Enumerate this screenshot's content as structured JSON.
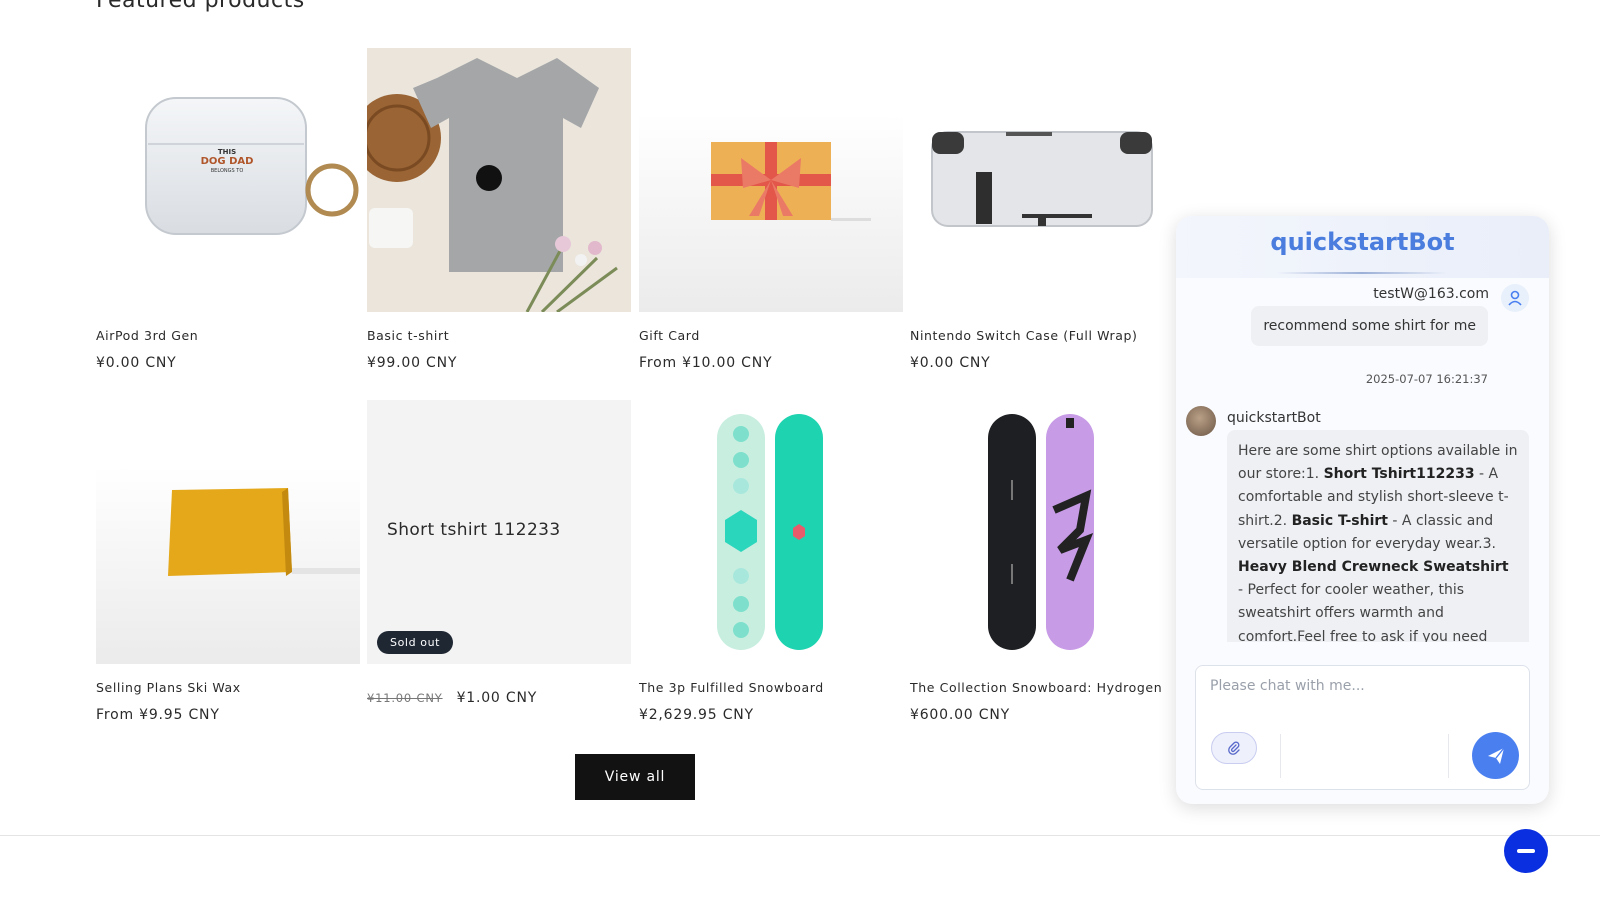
{
  "section": {
    "title": "Featured products"
  },
  "products": [
    {
      "title": "AirPod 3rd Gen",
      "price": "¥0.00 CNY"
    },
    {
      "title": "Basic t-shirt",
      "price": "¥99.00 CNY"
    },
    {
      "title": "Gift Card",
      "price": "From ¥10.00 CNY"
    },
    {
      "title": "Nintendo Switch Case (Full Wrap)",
      "price": "¥0.00 CNY"
    },
    {
      "title": "Selling Plans Ski Wax",
      "price": "From ¥9.95 CNY"
    },
    {
      "title": "",
      "placeholder": "Short tshirt 112233",
      "badge": "Sold out",
      "compare_price": "¥11.00 CNY",
      "price": "¥1.00 CNY"
    },
    {
      "title": "The 3p Fulfilled Snowboard",
      "price": "¥2,629.95 CNY"
    },
    {
      "title": "The Collection Snowboard: Hydrogen",
      "price": "¥600.00 CNY"
    }
  ],
  "view_all_label": "View all",
  "product_images": {
    "airpod_case_text": [
      "THIS",
      "DOG DAD",
      "BELONGS TO"
    ]
  },
  "chat": {
    "title": "quickstartBot",
    "user": {
      "name": "testW@163.com",
      "message": "recommend some shirt for me",
      "time": "2025-07-07 16:21:37"
    },
    "bot": {
      "name": "quickstartBot",
      "segments": [
        {
          "text": "Here are some shirt options available in our store:1. ",
          "bold": false
        },
        {
          "text": "Short Tshirt112233",
          "bold": true
        },
        {
          "text": " - A comfortable and stylish short-sleeve t-shirt.2. ",
          "bold": false
        },
        {
          "text": "Basic T-shirt",
          "bold": true
        },
        {
          "text": " - A classic and versatile option for everyday wear.3. ",
          "bold": false
        },
        {
          "text": "Heavy Blend Crewneck Sweatshirt",
          "bold": true
        },
        {
          "text": " - Perfect for cooler weather, this sweatshirt offers warmth and comfort.Feel free to ask if you need more details on any of these shirts!",
          "bold": false
        }
      ]
    },
    "input_placeholder": "Please chat with me...",
    "icons": {
      "user_avatar": "user-icon",
      "scroll": "chevron-down-icon",
      "attach": "paperclip-icon",
      "send": "send-icon"
    },
    "accent_color": "#4a7ff0"
  },
  "fab": {
    "icon": "chat-launcher-icon",
    "color": "#0a2fe0"
  }
}
